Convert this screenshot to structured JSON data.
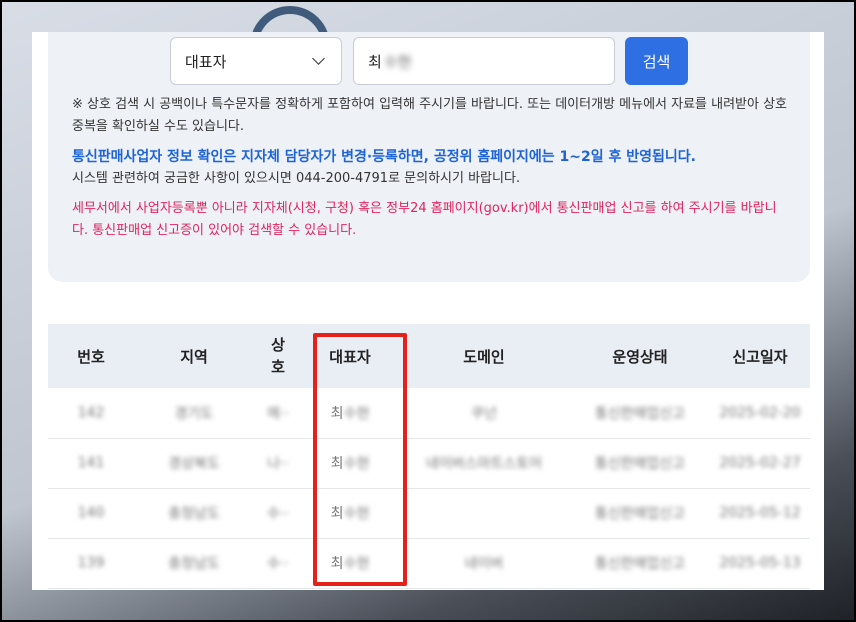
{
  "search": {
    "field_select": "대표자",
    "query_visible": "최",
    "query_blurred": "수현",
    "button_label": "검색"
  },
  "notes": {
    "line1": "※ 상호 검색 시 공백이나 특수문자를 정확하게 포함하여 입력해 주시기를 바랍니다. 또는 데이터개방 메뉴에서 자료를 내려받아 상호 중복을 확인하실 수도 있습니다.",
    "blue": "통신판매사업자 정보 확인은 지자체 담당자가 변경·등록하면, 공정위 홈페이지에는 1~2일 후 반영됩니다.",
    "line2": "시스템 관련하여 궁금한 사항이 있으시면 044-200-4791로 문의하시기 바랍니다.",
    "red": "세무서에서 사업자등록뿐 아니라 지자체(시청, 구청) 혹은 정부24 홈페이지(gov.kr)에서 통신판매업 신고를 하여 주시기를 바랍니다. 통신판매업 신고증이 있어야 검색할 수 있습니다."
  },
  "table": {
    "headers": [
      "번호",
      "지역",
      "상호",
      "대표자",
      "도메인",
      "운영상태",
      "신고일자"
    ],
    "rows": [
      {
        "no": "142",
        "region": "경기도",
        "name": "에··",
        "rep_visible": "최",
        "rep_blurred": "수현",
        "domain": "쿠넌",
        "status": "통신판매업신고",
        "date": "2025-02-20"
      },
      {
        "no": "141",
        "region": "경상북도",
        "name": "나··",
        "rep_visible": "최",
        "rep_blurred": "수현",
        "domain": "네이버스마트스토어",
        "status": "통신판매업신고",
        "date": "2025-02-27"
      },
      {
        "no": "140",
        "region": "충청남도",
        "name": "수··",
        "rep_visible": "최",
        "rep_blurred": "수현",
        "domain": "",
        "status": "통신판매업신고",
        "date": "2025-05-12"
      },
      {
        "no": "139",
        "region": "충청남도",
        "name": "수··",
        "rep_visible": "최",
        "rep_blurred": "수현",
        "domain": "네이버",
        "status": "통신판매업신고",
        "date": "2025-05-13"
      }
    ]
  },
  "colors": {
    "accent": "#2f6fe4",
    "highlight": "#e5211c",
    "notice_blue": "#1e63d6",
    "notice_red": "#e0245e"
  }
}
